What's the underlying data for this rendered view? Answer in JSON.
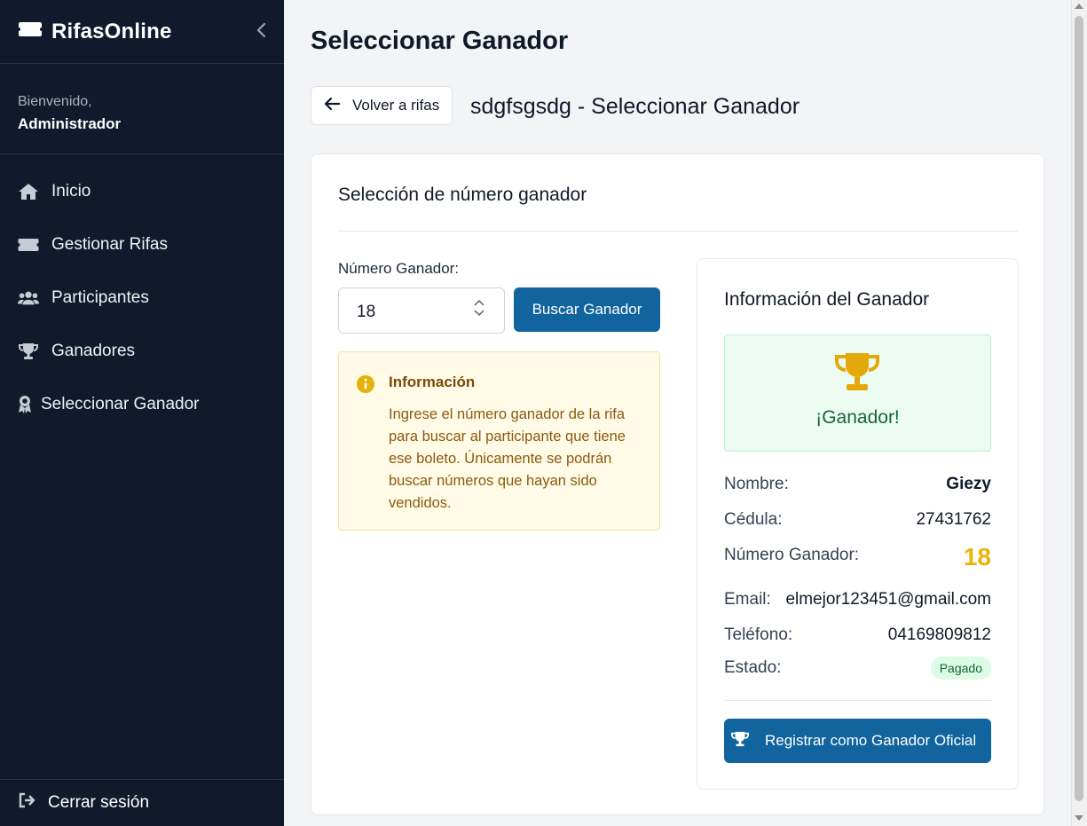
{
  "sidebar": {
    "brand": "RifasOnline",
    "brand_icon": "ticket-icon",
    "welcome_label": "Bienvenido,",
    "user_name": "Administrador",
    "items": [
      {
        "label": "Inicio",
        "icon": "home-icon"
      },
      {
        "label": "Gestionar Rifas",
        "icon": "ticket-icon"
      },
      {
        "label": "Participantes",
        "icon": "users-icon"
      },
      {
        "label": "Ganadores",
        "icon": "trophy-icon"
      },
      {
        "label": "Seleccionar Ganador",
        "icon": "award-icon"
      }
    ],
    "logout_label": "Cerrar sesión"
  },
  "header": {
    "title": "Seleccionar Ganador",
    "back_label": "Volver a rifas",
    "subtitle": "sdgfsgsdg - Seleccionar Ganador"
  },
  "selection": {
    "title": "Selección de número ganador",
    "number_label": "Número Ganador:",
    "number_value": "18",
    "search_button": "Buscar Ganador",
    "info_title": "Información",
    "info_text": "Ingrese el número ganador de la rifa para buscar al participante que tiene ese boleto. Únicamente se podrán buscar números que hayan sido vendidos."
  },
  "winner": {
    "title": "Información del Ganador",
    "banner": "¡Ganador!",
    "fields": {
      "nombre_label": "Nombre:",
      "nombre": "Giezy",
      "cedula_label": "Cédula:",
      "cedula": "27431762",
      "numero_label": "Número Ganador:",
      "numero": "18",
      "email_label": "Email:",
      "email": "elmejor123451@gmail.com",
      "telefono_label": "Teléfono:",
      "telefono": "04169809812",
      "estado_label": "Estado:",
      "estado": "Pagado"
    },
    "register_button": "Registrar como Ganador Oficial"
  },
  "colors": {
    "sidebar_bg": "#111a2c",
    "primary": "#11649e",
    "gold": "#eab308",
    "success": "#166534"
  }
}
